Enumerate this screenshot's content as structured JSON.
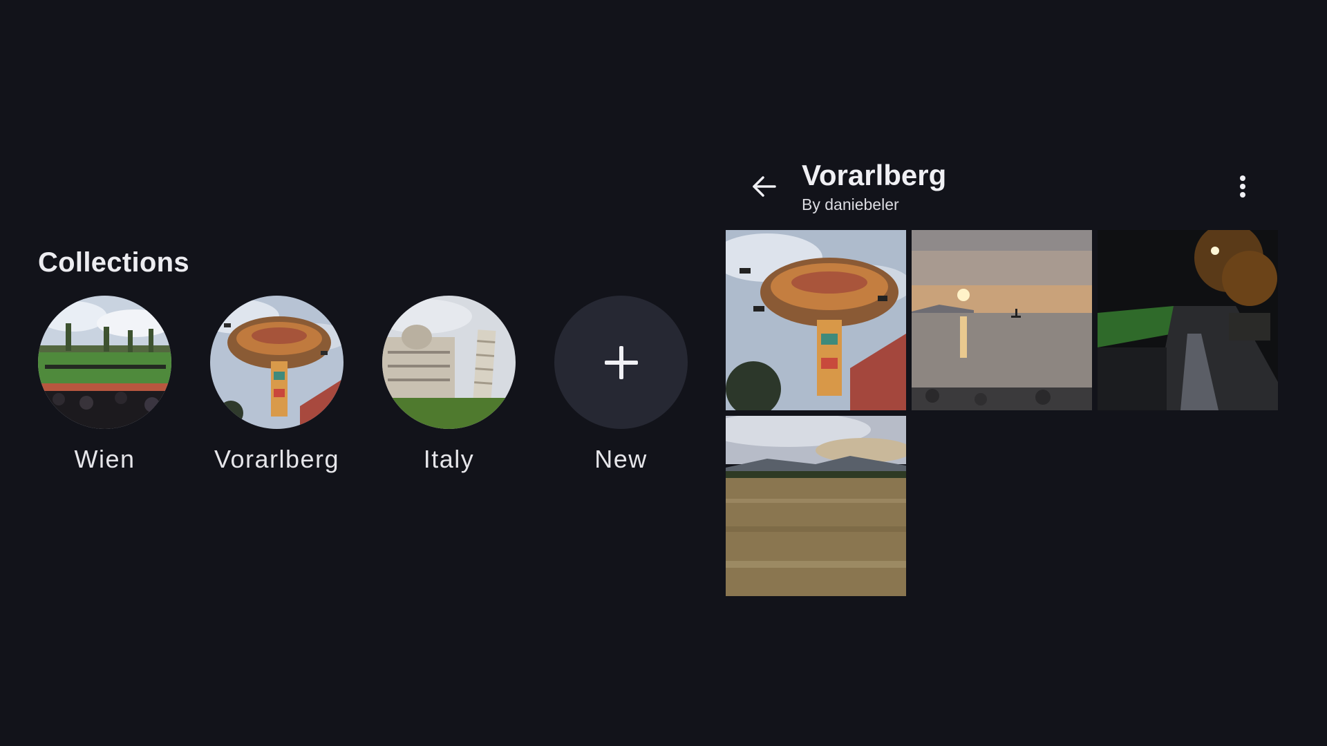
{
  "collections": {
    "title": "Collections",
    "items": [
      {
        "label": "Wien",
        "thumbnail": "stadium-crowd"
      },
      {
        "label": "Vorarlberg",
        "thumbnail": "chairswing-ride"
      },
      {
        "label": "Italy",
        "thumbnail": "leaning-tower-pisa"
      },
      {
        "label": "New",
        "icon": "plus-icon"
      }
    ]
  },
  "album": {
    "title": "Vorarlberg",
    "owner": "By daniebeler",
    "icons": {
      "back": "arrow-left-icon",
      "menu": "more-vertical-icon"
    },
    "photos": [
      {
        "subject": "chairswing-ride"
      },
      {
        "subject": "lake-sunset"
      },
      {
        "subject": "wet-street-night"
      },
      {
        "subject": "dry-field"
      }
    ]
  },
  "colors": {
    "background": "#12131a",
    "surface": "#262833",
    "text": "#e8e8ec"
  }
}
